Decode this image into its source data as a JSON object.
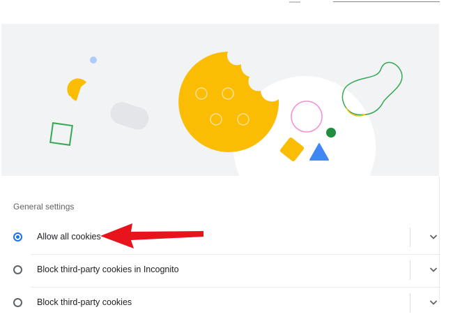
{
  "section": {
    "title": "General settings"
  },
  "options": [
    {
      "label": "Allow all cookies",
      "selected": true
    },
    {
      "label": "Block third-party cookies in Incognito",
      "selected": false
    },
    {
      "label": "Block third-party cookies",
      "selected": false
    }
  ],
  "colors": {
    "accent": "#1a73e8",
    "cookie": "#fbbc04",
    "annotation_arrow": "#e8141b"
  }
}
